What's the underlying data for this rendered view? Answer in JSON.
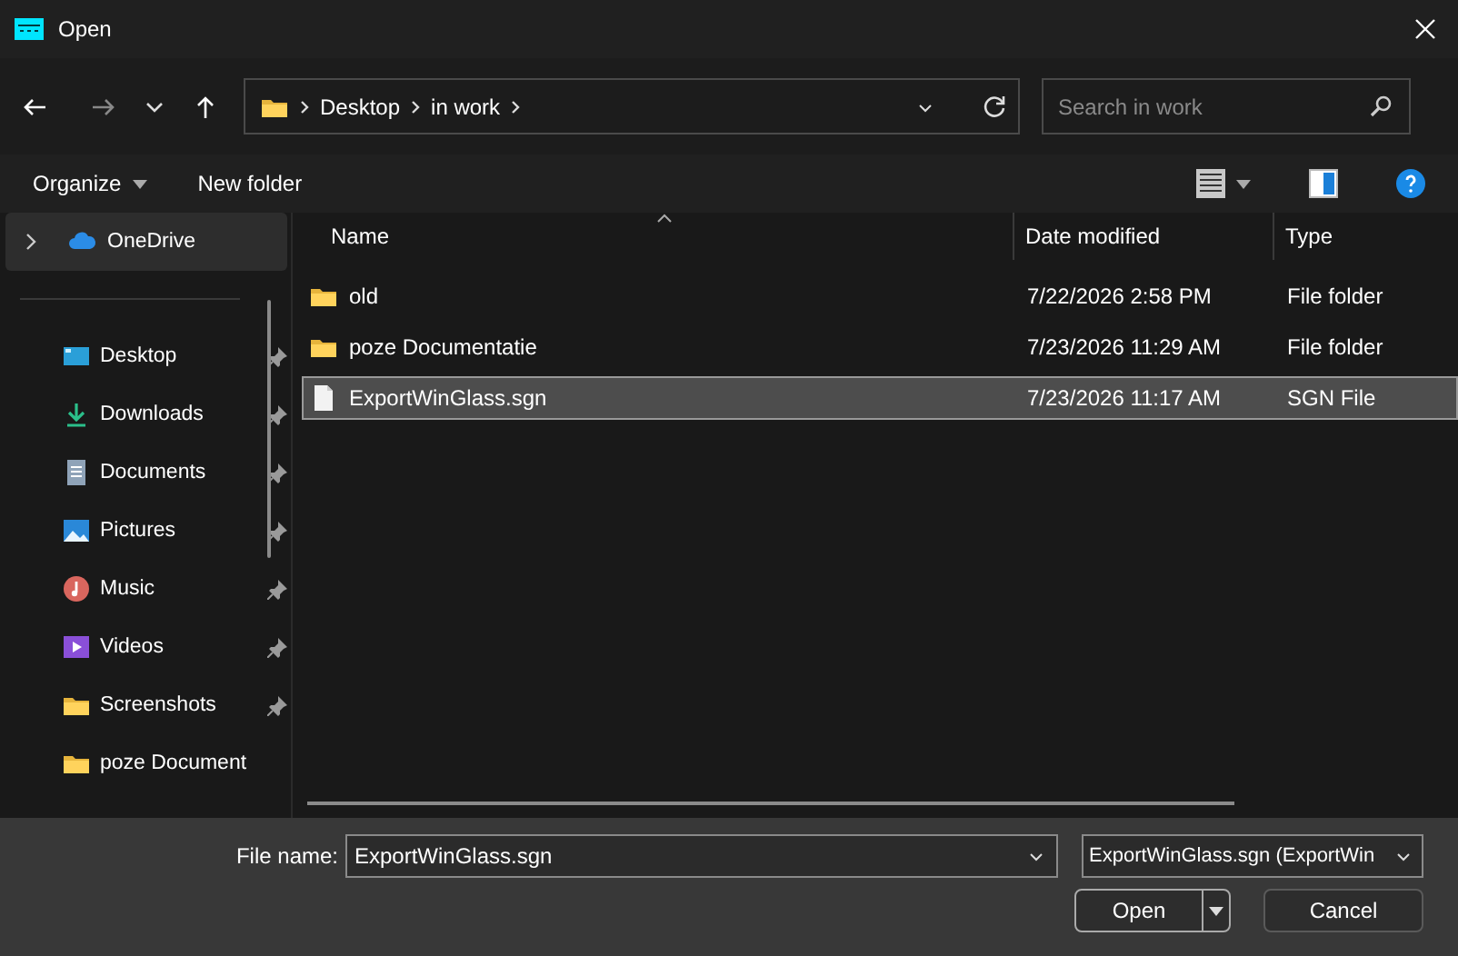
{
  "window": {
    "title": "Open"
  },
  "breadcrumb": [
    "Desktop",
    "in work"
  ],
  "search": {
    "placeholder": "Search in work"
  },
  "toolbar": {
    "organize": "Organize",
    "new_folder": "New folder"
  },
  "sidebar": {
    "onedrive": {
      "label": "OneDrive",
      "expanded": false,
      "selected": true
    },
    "quick_access": [
      {
        "label": "Desktop",
        "kind": "desktop",
        "pinned": true
      },
      {
        "label": "Downloads",
        "kind": "download",
        "pinned": true
      },
      {
        "label": "Documents",
        "kind": "document",
        "pinned": true
      },
      {
        "label": "Pictures",
        "kind": "picture",
        "pinned": true
      },
      {
        "label": "Music",
        "kind": "music",
        "pinned": true
      },
      {
        "label": "Videos",
        "kind": "video",
        "pinned": true
      },
      {
        "label": "Screenshots",
        "kind": "folder",
        "pinned": true
      },
      {
        "label": "poze Document",
        "kind": "folder",
        "pinned": false
      }
    ]
  },
  "table": {
    "columns": [
      "Name",
      "Date modified",
      "Type"
    ],
    "rows": [
      {
        "name": "old",
        "date": "7/22/2026 2:58 PM",
        "type": "File folder",
        "kind": "folder",
        "selected": false
      },
      {
        "name": "poze Documentatie",
        "date": "7/23/2026 11:29 AM",
        "type": "File folder",
        "kind": "folder",
        "selected": false
      },
      {
        "name": "ExportWinGlass.sgn",
        "date": "7/23/2026 11:17 AM",
        "type": "SGN File",
        "kind": "file",
        "selected": true
      }
    ]
  },
  "footer": {
    "file_name_label": "File name:",
    "file_name": "ExportWinGlass.sgn",
    "file_type": "ExportWinGlass.sgn (ExportWin",
    "open": "Open",
    "cancel": "Cancel"
  }
}
